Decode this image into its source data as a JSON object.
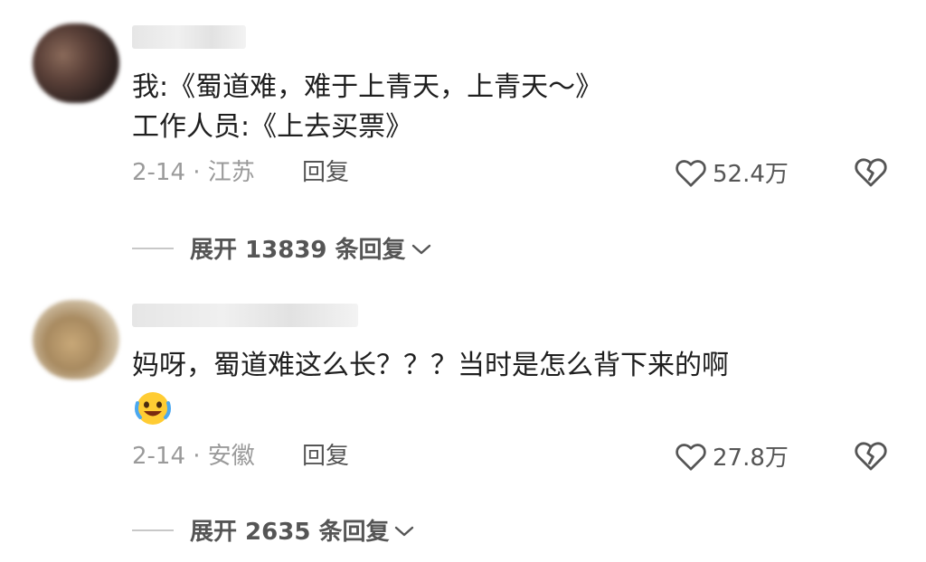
{
  "comments": [
    {
      "text_line1": "我:《蜀道难，难于上青天，上青天～》",
      "text_line2": "工作人员:《上去买票》",
      "date_location": "2-14 · 江苏",
      "reply_label": "回复",
      "likes": "52.4万",
      "expand_label": "展开 13839 条回复",
      "icons": {
        "like": "heart-outline-icon",
        "dislike": "broken-heart-icon",
        "expand": "chevron-down-icon"
      }
    },
    {
      "text_line1": "妈呀，蜀道难这么长？？？当时是怎么背下来的啊",
      "emoji": "laughing-crying-emoji",
      "date_location": "2-14 · 安徽",
      "reply_label": "回复",
      "likes": "27.8万",
      "expand_label": "展开 2635 条回复",
      "icons": {
        "like": "heart-outline-icon",
        "dislike": "broken-heart-icon",
        "expand": "chevron-down-icon"
      }
    }
  ],
  "colors": {
    "text": "#1f1f1f",
    "meta": "#9a9a9a",
    "action": "#555555"
  }
}
